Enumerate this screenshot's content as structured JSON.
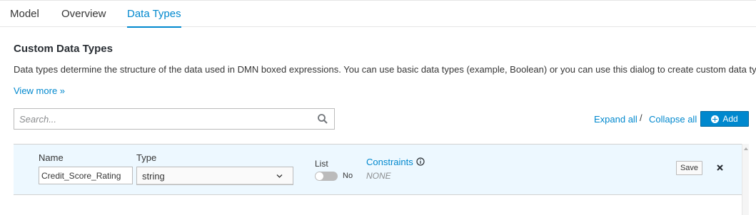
{
  "tabs": [
    {
      "label": "Model"
    },
    {
      "label": "Overview"
    },
    {
      "label": "Data Types",
      "active": true
    }
  ],
  "section": {
    "title": "Custom Data Types",
    "description": "Data types determine the structure of the data used in DMN boxed expressions. You can use basic data types (example, Boolean) or you can use this dialog to create custom data types.",
    "view_more": "View more »"
  },
  "search": {
    "placeholder": "Search...",
    "value": ""
  },
  "toolbar": {
    "expand_all": "Expand all",
    "separator": "/",
    "collapse_all": "Collapse all",
    "add_label": "Add"
  },
  "row": {
    "name_label": "Name",
    "name_value": "Credit_Score_Rating",
    "type_label": "Type",
    "type_value": "string",
    "list_label": "List",
    "list_toggle_text": "No",
    "constraints_label": "Constraints",
    "constraints_value": "NONE",
    "save_label": "Save"
  },
  "colors": {
    "accent": "#0088ce",
    "row_bg": "#edf8ff"
  },
  "icons": [
    "search-icon",
    "plus-circle-icon",
    "chevron-down-icon",
    "info-icon",
    "close-icon"
  ]
}
